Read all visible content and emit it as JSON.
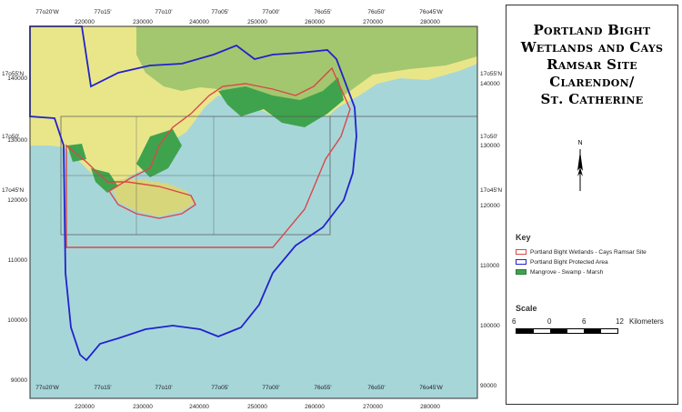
{
  "title_lines": [
    "Portland Bight",
    "Wetlands and Cays",
    "Ramsar Site",
    "Clarendon/",
    "St. Catherine"
  ],
  "north_label": "N",
  "key": {
    "title": "Key",
    "items": [
      {
        "label": "Portland Bight Wetlands - Cays Ramsar Site",
        "color": "#d8484a"
      },
      {
        "label": "Portland Bight Protected Area",
        "color": "#2222cc"
      },
      {
        "label": "Mangrove - Swamp - Marsh",
        "color": "#3fa34d"
      }
    ]
  },
  "scale": {
    "title": "Scale",
    "labels": [
      "6",
      "0",
      "6",
      "12",
      "Kilometers"
    ]
  },
  "map": {
    "top_labels": [
      "77o20'W",
      "77o15'",
      "77o10'",
      "77o05'",
      "77o00'",
      "76o55'",
      "76o50'",
      "76o45'W"
    ],
    "top_easting": [
      "220000",
      "230000",
      "240000",
      "250000",
      "260000",
      "270000",
      "280000"
    ],
    "bottom_labels": [
      "77o20'W",
      "77o15'",
      "77o10'",
      "77o05'",
      "77o00'",
      "76o55'",
      "76o50'",
      "76o45'W"
    ],
    "bottom_easting": [
      "220000",
      "230000",
      "240000",
      "250000",
      "260000",
      "270000",
      "280000"
    ],
    "left_lat": [
      "17o55'N",
      "17o50'",
      "17o45'N"
    ],
    "left_northing": [
      "140000",
      "130000",
      "120000",
      "110000",
      "100000",
      "90000"
    ],
    "right_lat": [
      "17o55'N",
      "17o50'",
      "17o45'N"
    ],
    "right_northing": [
      "140000",
      "130000",
      "120000",
      "110000",
      "100000",
      "90000"
    ]
  },
  "colors": {
    "sea": "#a7d6d9",
    "land_yellow": "#e9e68a",
    "land_green": "#9bc36a",
    "mangrove": "#3fa34d",
    "ramsar": "#d8484a",
    "protected": "#2222cc"
  }
}
